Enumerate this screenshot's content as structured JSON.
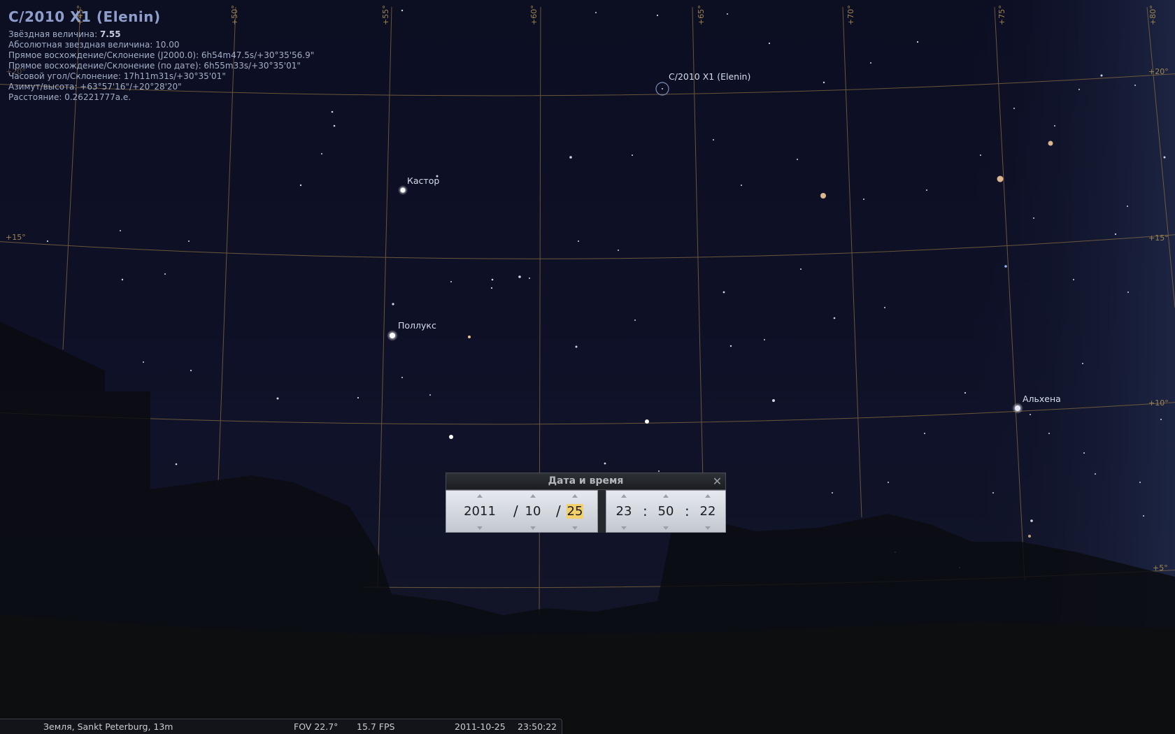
{
  "object_info": {
    "title": "C/2010 X1 (Elenin)",
    "magnitude_label": "Звёздная величина: ",
    "magnitude_value": "7.55",
    "abs_magnitude": "Абсолютная звездная величина: 10.00",
    "ra_dec_j2000": "Прямое восхождение/Склонение (J2000.0): 6h54m47.5s/+30°35'56.9\"",
    "ra_dec_date": "Прямое восхождение/Склонение (по дате): 6h55m33s/+30°35'01\"",
    "hour_angle": "Часовой угол/Склонение: 17h11m31s/+30°35'01\"",
    "az_alt": "Азимут/высота: +63°57'16\"/+20°28'20\"",
    "distance": "Расстояние: 0.26221777а.е."
  },
  "sky_labels": {
    "comet": "C/2010 X1 (Elenin)",
    "castor": "Кастор",
    "pollux": "Поллукс",
    "alhena": "Альхена"
  },
  "grid_labels": {
    "az": [
      "+45°",
      "+50°",
      "+55°",
      "+60°",
      "+65°",
      "+70°",
      "+75°",
      "+80°"
    ],
    "alt": [
      "+20°",
      "+15°",
      "+15°",
      "+10°",
      "+5°",
      "+20°"
    ]
  },
  "dialog": {
    "title": "Дата и время",
    "close_icon": "close-icon",
    "year": "2011",
    "month": "10",
    "day": "25",
    "hour": "23",
    "minute": "50",
    "second": "22",
    "date_sep": "/",
    "time_sep": ":"
  },
  "statusbar": {
    "location": "Земля, Sankt Peterburg, 13m",
    "fov": "FOV 22.7°",
    "fps": "15.7 FPS",
    "date": "2011-10-25",
    "time": "23:50:22"
  },
  "colors": {
    "sky": "#0d0f24",
    "grid": "#8a6d3f",
    "dialog_highlight": "#f4d06a"
  }
}
